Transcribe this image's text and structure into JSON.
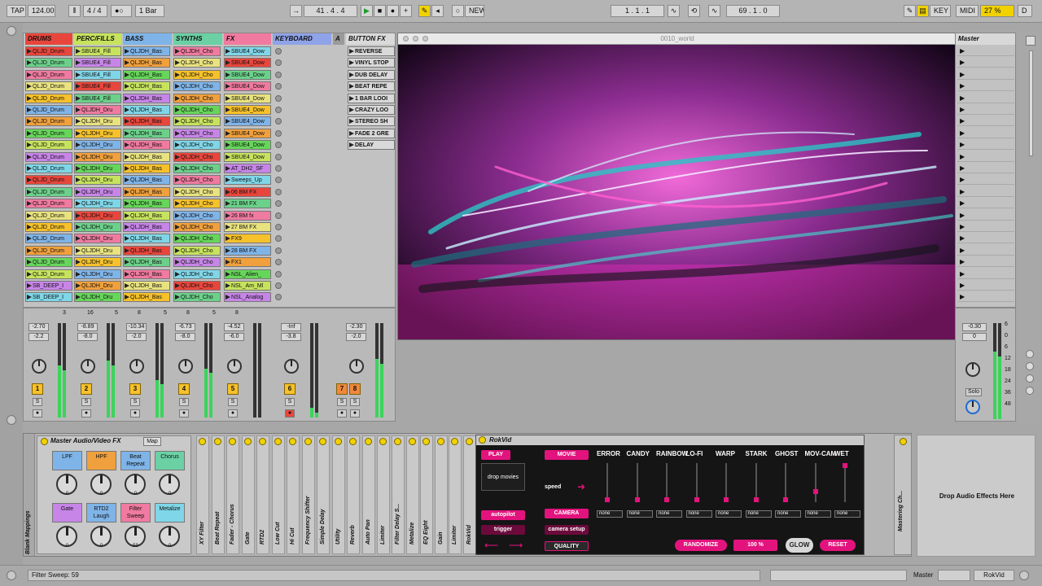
{
  "toolbar": {
    "tap": "TAP",
    "tempo": "124.00",
    "signature": "4 / 4",
    "quantize": "1 Bar",
    "position": "41 . 4 . 4",
    "new": "NEW",
    "loop_start": "1 . 1 . 1",
    "loop_length": "69 . 1 . 0",
    "key": "KEY",
    "midi": "MIDI",
    "cpu": "27 %",
    "d": "D"
  },
  "tracks": [
    {
      "name": "DRUMS",
      "color": "#e8463c"
    },
    {
      "name": "PERC/FILLS",
      "color": "#c7e35e"
    },
    {
      "name": "BASS",
      "color": "#7fb4e8"
    },
    {
      "name": "SYNTHS",
      "color": "#6bd1a5"
    },
    {
      "name": "FX",
      "color": "#f07aa0"
    },
    {
      "name": "KEYBOARD",
      "color": "#8fa3e8"
    },
    {
      "name": "A",
      "color": "#9a9a9a"
    },
    {
      "name": "BUTTON FX",
      "color": "#d9d9d9"
    }
  ],
  "clips": {
    "drums": [
      "QLJD_Drum",
      "QLJD_Drum",
      "QLJD_Drum",
      "QLJD_Drum",
      "QLJD_Drum",
      "QLJD_Drum",
      "QLJD_Drum",
      "QLJD_Drum",
      "QLJD_Drum",
      "QLJD_Drum",
      "QLJD_Drum",
      "QLJD_Drum",
      "QLJD_Drum",
      "QLJD_Drum",
      "QLJD_Drum",
      "QLJD_Drum",
      "QLJD_Drum",
      "QLJD_Drum",
      "QLJD_Drum",
      "QLJD_Drum",
      "SB_DEEP_I",
      "SB_DEEP_I"
    ],
    "perc": [
      "SBUE4_Fill",
      "SBUE4_Fill",
      "SBUE4_Fill",
      "SBUE4_Fill",
      "SBUE4_Fill",
      "QLJDH_Dru",
      "QLJDH_Dru",
      "QLJDH_Dru",
      "QLJDH_Dru",
      "QLJDH_Dru",
      "QLJDH_Dru",
      "QLJDH_Dru",
      "QLJDH_Dru",
      "QLJDH_Dru",
      "QLJDH_Dru",
      "QLJDH_Dru",
      "QLJDH_Dru",
      "QLJDH_Dru",
      "QLJDH_Dru",
      "QLJDH_Dru",
      "QLJDH_Dru",
      "QLJDH_Dru"
    ],
    "bass": [
      "QLJDH_Bas",
      "QLJDH_Bas",
      "QLJDH_Bas",
      "QLJDH_Bas",
      "QLJDH_Bas",
      "QLJDH_Bas",
      "QLJDH_Bas",
      "QLJDH_Bas",
      "QLJDH_Bas",
      "QLJDH_Bas",
      "QLJDH_Bas",
      "QLJDH_Bas",
      "QLJDH_Bas",
      "QLJDH_Bas",
      "QLJDH_Bas",
      "QLJDH_Bas",
      "QLJDH_Bas",
      "QLJDH_Bas",
      "QLJDH_Bas",
      "QLJDH_Bas",
      "QLJDH_Bas",
      "QLJDH_Bas"
    ],
    "synths": [
      "QLJDH_Cho",
      "QLJDH_Cho",
      "QLJDH_Cho",
      "QLJDH_Cho",
      "QLJDH_Cho",
      "QLJDH_Cho",
      "QLJDH_Cho",
      "QLJDH_Cho",
      "QLJDH_Cho",
      "QLJDH_Cho",
      "QLJDH_Cho",
      "QLJDH_Cho",
      "QLJDH_Cho",
      "QLJDH_Cho",
      "QLJDH_Cho",
      "QLJDH_Cho",
      "QLJDH_Cho",
      "QLJDH_Cho",
      "QLJDH_Cho",
      "QLJDH_Cho",
      "QLJDH_Cho",
      "QLJDH_Cho"
    ],
    "fx": [
      "SBUE4_Dow",
      "SBUE4_Dow",
      "SBUE4_Dow",
      "SBUE4_Dow",
      "SBUE4_Dow",
      "SBUE4_Dow",
      "SBUE4_Dow",
      "SBUE4_Dow",
      "SBUE4_Dow",
      "SBUE4_Dow",
      "AT_DH2_SF",
      "Sweeps_Up",
      "06 BM FX",
      "21 BM FX",
      "26 BM fx",
      "27 BM FX",
      "FX9",
      "28 BM FX",
      "FX1",
      "NSL_Alien_",
      "NSL_Am_Ml",
      "NSL_Analog"
    ],
    "buttonfx": [
      "REVERSE",
      "VINYL STOP",
      "DUB DELAY",
      "BEAT REPE",
      "1 BAR LOOI",
      "CRAZY LOO",
      "STEREO SH",
      "FADE 2 GRE",
      "DELAY"
    ]
  },
  "video_title": "0010_world",
  "master_title": "Master",
  "mixer": {
    "vols": [
      [
        "-2.70",
        "-2.2"
      ],
      [
        "-8.89",
        "-8.0"
      ],
      [
        "-10.34",
        "-2.0"
      ],
      [
        "-6.73",
        "-8.0"
      ],
      [
        "-4.52",
        "-6.0"
      ],
      [
        "-Inf",
        "-3.8"
      ],
      [
        "-2.30",
        "-2.0"
      ]
    ],
    "nums": [
      "1",
      "2",
      "3",
      "4",
      "5",
      "6",
      "7",
      "8"
    ],
    "db_scale": [
      "6",
      "0",
      "6",
      "12",
      "18",
      "24",
      "36",
      "48"
    ],
    "master_vol": [
      "-0.30",
      "0"
    ],
    "solo": "Solo",
    "s": "S",
    "sends": [
      "3",
      "16",
      "5",
      "8",
      "5",
      "8",
      "5",
      "8"
    ]
  },
  "device": {
    "rack_title": "Master Audio/Video FX",
    "map": "Map",
    "macros": [
      "LPF",
      "HPF",
      "Beat Repeat",
      "Chorus",
      "Gate",
      "RTD2 Laugh",
      "Filter Sweep",
      "Metalize"
    ],
    "macro_values": [
      "0",
      "0",
      "0",
      "0",
      "0",
      "0",
      "59",
      "0"
    ],
    "chain_left": [
      "XY Filter",
      "Beat Repeat",
      "Fader - Chorus",
      "Gate",
      "RTD2",
      "Low Cut",
      "Hi Cut",
      "Frequency Shifter",
      "Simple Delay",
      "Utility",
      "Reverb",
      "Auto Pan",
      "Limiter"
    ],
    "chain_right": [
      "Filter Delay S...",
      "Metalize",
      "EQ Eight",
      "Gain",
      "Limiter",
      "RokVid"
    ],
    "blank_mappings": "Blank Mappings",
    "mastering": "Mastering Ch...",
    "drop_audio": "Drop Audio Effects Here"
  },
  "rokvid": {
    "title": "RokVid",
    "play": "PLAY",
    "drop_movies": "drop movies",
    "movie": "MOVIE",
    "speed": "speed",
    "autopilot": "autopilot",
    "trigger": "trigger",
    "camera": "CAMERA",
    "camera_setup": "camera setup",
    "quality": "QUALITY",
    "effects": [
      "ERROR",
      "CANDY",
      "RAINBOW",
      "LO-FI",
      "WARP",
      "STARK",
      "GHOST",
      "MOV-CAM",
      "WET"
    ],
    "none": "none",
    "randomize": "RANDOMIZE",
    "percent": "100 %",
    "glow": "GLOW",
    "reset": "RESET"
  },
  "status": {
    "text": "Filter Sweep: 59",
    "track": "Master",
    "device": "RokVid"
  }
}
